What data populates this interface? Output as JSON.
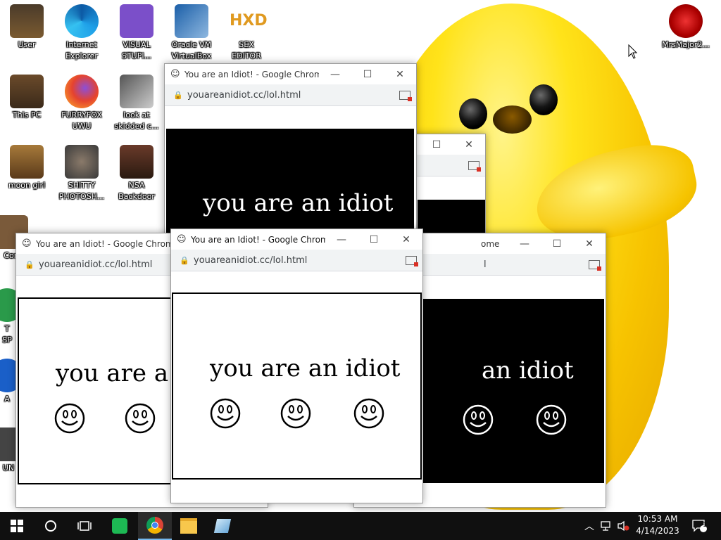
{
  "desktop": {
    "icons": [
      {
        "label": "User"
      },
      {
        "label": "Internet\nExplorer"
      },
      {
        "label": "VISUAL\nSTUPI..."
      },
      {
        "label": "Oracle VM\nVirtualBox"
      },
      {
        "label": "SEX\nEDITOR"
      },
      {
        "label": "MrsMajor2..."
      },
      {
        "label": "This PC"
      },
      {
        "label": "FURRYFOX\nUWU"
      },
      {
        "label": "look at\nskidded c..."
      },
      {
        "label": "moon girl"
      },
      {
        "label": "SHITTY\nPHOTOSH..."
      },
      {
        "label": "NSA\nBackdoor"
      },
      {
        "label": "Con"
      },
      {
        "label": "T\nSP"
      },
      {
        "label": "A"
      },
      {
        "label": "UN"
      }
    ]
  },
  "windows": {
    "title": "You are an Idiot! - Google Chrome",
    "title_fragment": "Chrome",
    "title_fragment_right": "ome",
    "url": "youareanidiot.cc/lol.html",
    "url_fragment": "l",
    "message": "you are an idiot",
    "message_part_a": "you are a",
    "message_part_iot": "iot",
    "message_part_an": "an idiot"
  },
  "taskbar": {
    "start": "windows-start",
    "time": "10:53 AM",
    "date": "4/14/2023",
    "notification_count": "1"
  },
  "colors": {
    "taskbar": "#101010",
    "bird_yellow": "#ffe31a",
    "chrome_toolbar": "#f1f3f4"
  }
}
